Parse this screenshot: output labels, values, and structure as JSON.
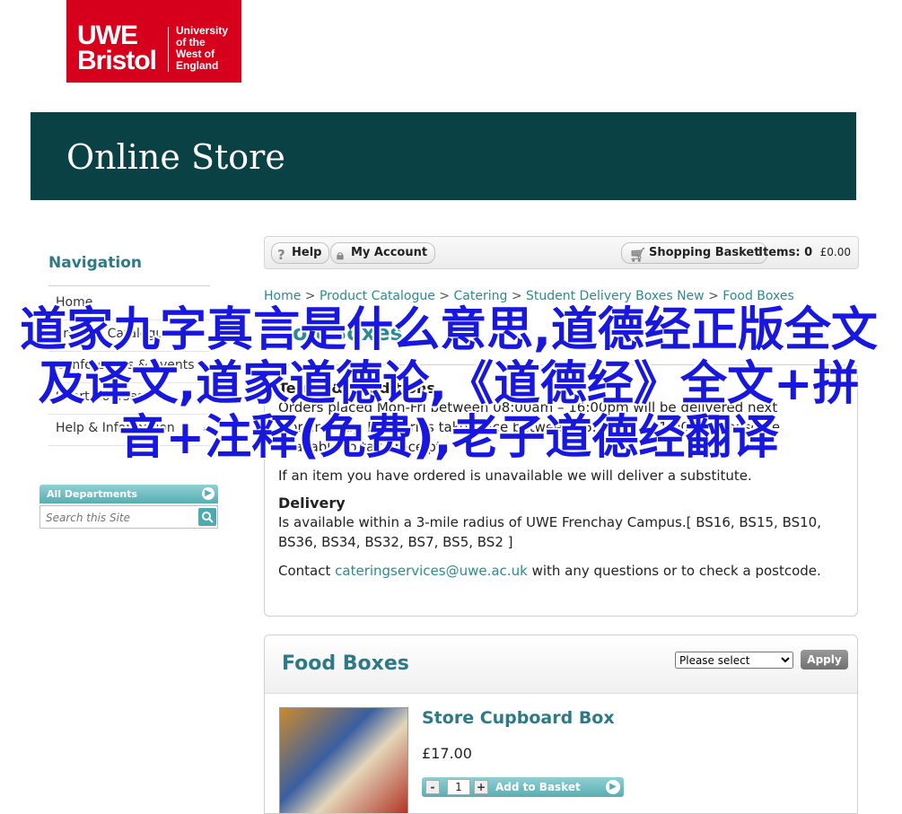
{
  "logo": {
    "brand": "UWE Bristol",
    "brand_line1": "UWE",
    "brand_line2": "Bristol",
    "sub": [
      "University",
      "of the",
      "West of",
      "England"
    ]
  },
  "banner": {
    "title": "Online Store"
  },
  "sidebar": {
    "title": "Navigation",
    "items": [
      {
        "label": "Home"
      },
      {
        "label": "Product Catalogue"
      },
      {
        "label": "Conferences & Events"
      },
      {
        "label": "Short Courses"
      },
      {
        "label": "Help & Information"
      }
    ],
    "departments_label": "All Departments",
    "search_placeholder": "Search this Site"
  },
  "toolbar": {
    "help": "Help",
    "account": "My Account",
    "basket": "Shopping Basket",
    "items_label": "Items:",
    "items_count": "0",
    "items_amount": "£0.00"
  },
  "breadcrumb": [
    "Home",
    "Product Catalogue",
    "Catering",
    "Student Delivery Boxes New",
    "Food Boxes"
  ],
  "breadcrumb_sep": ">",
  "page_title": "Food Boxes",
  "info": {
    "terms_heading": "Terms & Conditions",
    "terms_text": "Orders placed Mon-Fri between 08:00am – 16:00pm will be delivered next working day. Deliveries take place between 06:00am – 11:00am please be available to take receipt.",
    "substitute_text": "If an item you have ordered is unavailable we will deliver a substitute.",
    "delivery_heading": "Delivery",
    "delivery_text": "Is available within a 3-mile radius of UWE Frenchay Campus.[ BS16, BS15, BS10, BS36, BS34, BS32, BS7, BS5, BS2 ]",
    "contact_prefix": "Contact",
    "contact_email": "cateringservices@uwe.ac.uk",
    "contact_suffix": "with any questions or to check a postcode."
  },
  "panel": {
    "title": "Food Boxes",
    "sort_value": "Please select",
    "apply": "Apply",
    "product": {
      "name": "Store Cupboard Box",
      "price": "£17.00",
      "qty": "1",
      "minus": "-",
      "plus": "+",
      "add_label": "Add to Basket"
    }
  },
  "overlay": {
    "text": "道家九字真言是什么意思,道德经正版全文及译文,道家道德论,《道德经》全文+拼音+注释(免费),老子道德经翻译"
  },
  "colors": {
    "brand_red": "#d6001c",
    "banner": "#0a4145",
    "accent": "#2d8a90",
    "overlay": "#1717e0"
  }
}
